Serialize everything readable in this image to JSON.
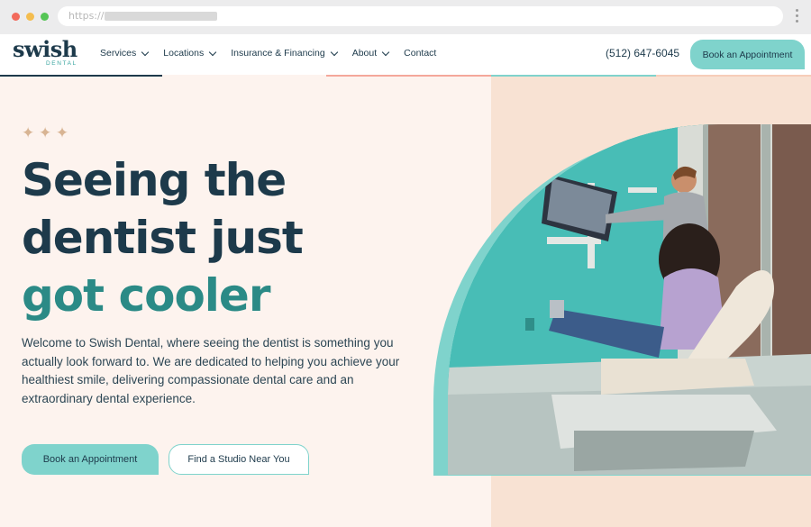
{
  "browser": {
    "url_prefix": "https://"
  },
  "brand": {
    "logo_main": "swish",
    "logo_sub": "DENTAL",
    "colors": {
      "navy": "#1d3a4b",
      "teal": "#7fd3cc",
      "teal_dark": "#2b8a86",
      "peach_bg": "#fdf3ee",
      "peach_panel": "#f8e2d3",
      "star": "#d8b493"
    }
  },
  "nav": {
    "items": [
      {
        "label": "Services",
        "has_dropdown": true
      },
      {
        "label": "Locations",
        "has_dropdown": true
      },
      {
        "label": "Insurance & Financing",
        "has_dropdown": true
      },
      {
        "label": "About",
        "has_dropdown": true
      },
      {
        "label": "Contact",
        "has_dropdown": false
      }
    ],
    "phone": "(512) 647-6045",
    "book_label": "Book an Appointment"
  },
  "hero": {
    "stars": "✦ ✦ ✦",
    "headline_line1": "Seeing the",
    "headline_line2": "dentist just",
    "headline_line3": "got cooler",
    "intro": "Welcome to Swish Dental, where seeing the dentist is something you actually look forward to. We are dedicated to helping you achieve your healthiest smile, delivering compassionate dental care and an extraordinary dental experience.",
    "primary_cta": "Book an Appointment",
    "secondary_cta": "Find a Studio Near You",
    "image_icon": "dental-office-photo"
  }
}
